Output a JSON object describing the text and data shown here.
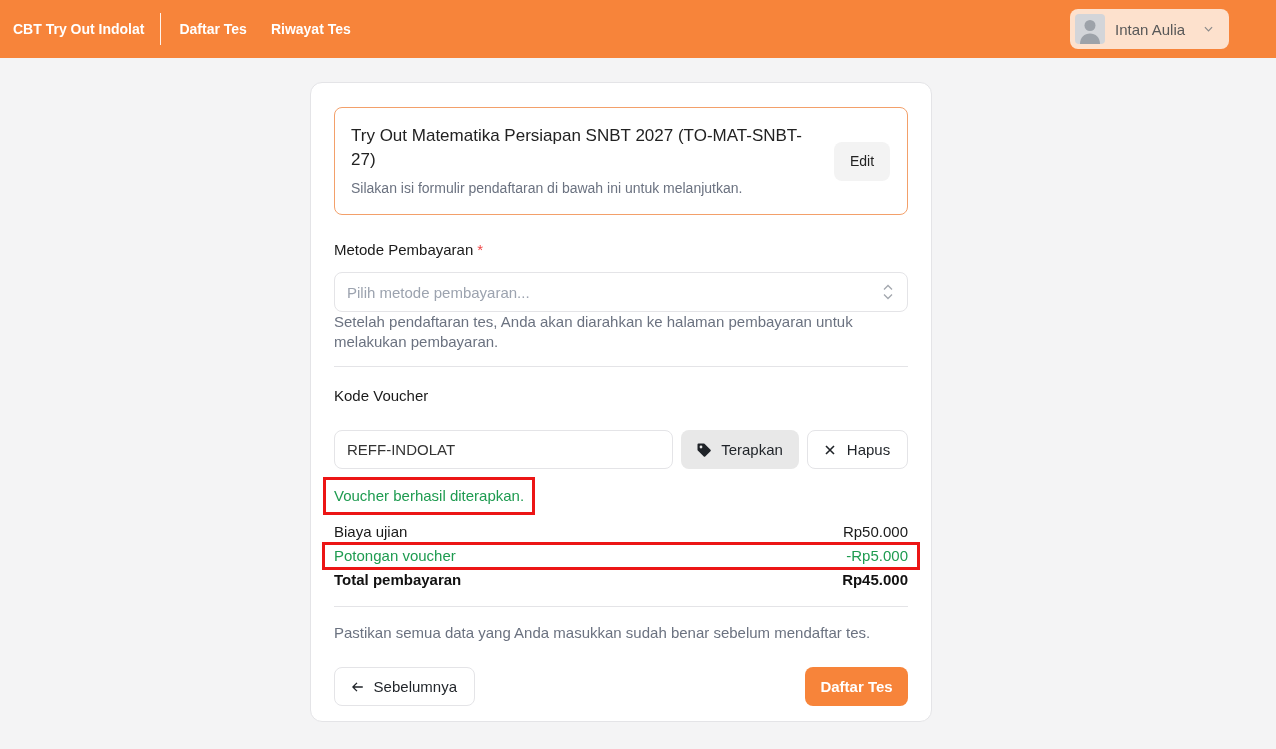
{
  "header": {
    "brand": "CBT Try Out Indolat",
    "nav": [
      {
        "label": "Daftar Tes"
      },
      {
        "label": "Riwayat Tes"
      }
    ],
    "user": {
      "name": "Intan Aulia"
    }
  },
  "test_card": {
    "title": "Try Out Matematika Persiapan SNBT 2027 (TO-MAT-SNBT-27)",
    "subtitle": "Silakan isi formulir pendaftaran di bawah ini untuk melanjutkan.",
    "edit_button": "Edit"
  },
  "payment_method": {
    "label": "Metode Pembayaran",
    "required_mark": "*",
    "placeholder": "Pilih metode pembayaran...",
    "help": "Setelah pendaftaran tes, Anda akan diarahkan ke halaman pembayaran untuk melakukan pembayaran."
  },
  "voucher": {
    "label": "Kode Voucher",
    "value": "REFF-INDOLAT",
    "apply_button": "Terapkan",
    "remove_button": "Hapus",
    "message": {
      "text": "Voucher berhasil diterapkan.",
      "highlighted": true
    }
  },
  "summary": [
    {
      "kind": "fee",
      "label": "Biaya ujian",
      "amount": "Rp50.000",
      "highlighted": false
    },
    {
      "kind": "discount",
      "label": "Potongan voucher",
      "amount": "-Rp5.000",
      "highlighted": true
    },
    {
      "kind": "total",
      "label": "Total pembayaran",
      "amount": "Rp45.000",
      "highlighted": false
    }
  ],
  "note": "Pastikan semua data yang Anda masukkan sudah benar sebelum mendaftar tes.",
  "actions": {
    "back_button": "Sebelumnya",
    "submit_button": "Daftar Tes"
  }
}
